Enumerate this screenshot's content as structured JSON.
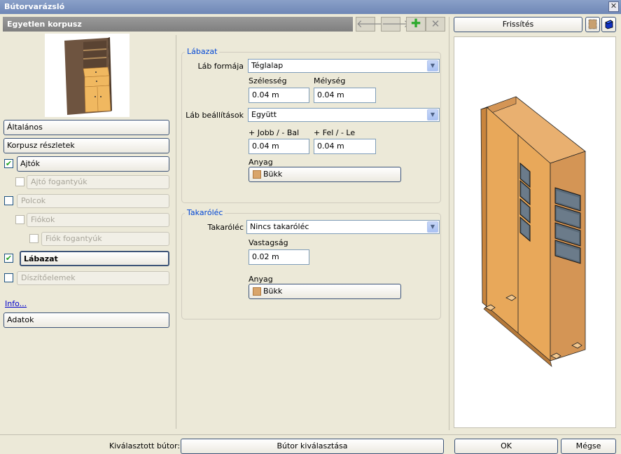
{
  "window": {
    "title": "Bútorvarázsló"
  },
  "header": {
    "title": "Egyetlen korpusz"
  },
  "icons": {
    "back": "arrow-left-icon",
    "forward": "arrow-right-icon",
    "add": "plus-icon",
    "delete": "x-icon",
    "close": "close-icon",
    "texture": "texture-icon",
    "cube": "cube-icon"
  },
  "sidebar": {
    "general": "Általános",
    "korpusz": "Korpusz részletek",
    "ajtok": "Ajtók",
    "ajto_fogantyuk": "Ajtó fogantyúk",
    "polcok": "Polcok",
    "fiokok": "Fiókok",
    "fiok_fogantyuk": "Fiók fogantyúk",
    "labazat": "Lábazat",
    "diszitoelemek": "Díszítőelemek",
    "info": "Info...",
    "adatok": "Adatok"
  },
  "labazat": {
    "group_title": "Lábazat",
    "shape_label": "Láb formája",
    "shape_value": "Téglalap",
    "width_label": "Szélesség",
    "width_value": "0.04 m",
    "depth_label": "Mélység",
    "depth_value": "0.04 m",
    "settings_label": "Láb beállítások",
    "settings_value": "Együtt",
    "right_left_label": "+ Jobb / - Bal",
    "right_left_value": "0.04 m",
    "up_down_label": "+ Fel / - Le",
    "up_down_value": "0.04 m",
    "material_label": "Anyag",
    "material_value": "Bükk"
  },
  "takarolec": {
    "group_title": "Takaróléc",
    "type_label": "Takaróléc",
    "type_value": "Nincs takaróléc",
    "thickness_label": "Vastagság",
    "thickness_value": "0.02 m",
    "material_label": "Anyag",
    "material_value": "Bükk"
  },
  "preview": {
    "refresh": "Frissítés"
  },
  "footer": {
    "selected_label": "Kiválasztott bútor:",
    "select_button": "Bútor kiválasztása",
    "ok": "OK",
    "cancel": "Mégse"
  },
  "colors": {
    "wood": "#e8a85a",
    "wood_dark": "#c9853d",
    "accent": "#0046d5"
  }
}
